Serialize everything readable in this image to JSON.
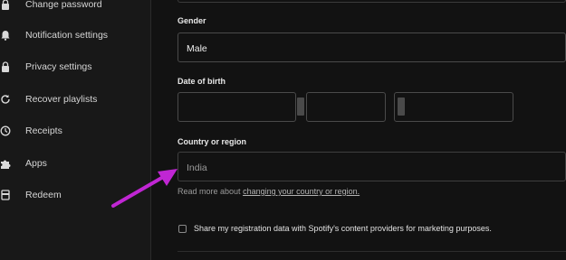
{
  "sidebar": {
    "items": [
      {
        "label": "Change password",
        "icon": "lock-icon"
      },
      {
        "label": "Notification settings",
        "icon": "bell-icon"
      },
      {
        "label": "Privacy settings",
        "icon": "lock-icon"
      },
      {
        "label": "Recover playlists",
        "icon": "refresh-icon"
      },
      {
        "label": "Receipts",
        "icon": "clock-icon"
      },
      {
        "label": "Apps",
        "icon": "puzzle-icon"
      },
      {
        "label": "Redeem",
        "icon": "card-icon"
      }
    ]
  },
  "form": {
    "gender": {
      "label": "Gender",
      "value": "Male"
    },
    "dob": {
      "label": "Date of birth"
    },
    "country": {
      "label": "Country or region",
      "value": "India"
    },
    "read_more_prefix": "Read more about",
    "read_more_link": "changing your country or region.",
    "share_label": "Share my registration data with Spotify's content providers for marketing purposes."
  },
  "colors": {
    "background": "#121212",
    "sidebar": "#181818",
    "annotation_arrow": "#c026d3"
  }
}
